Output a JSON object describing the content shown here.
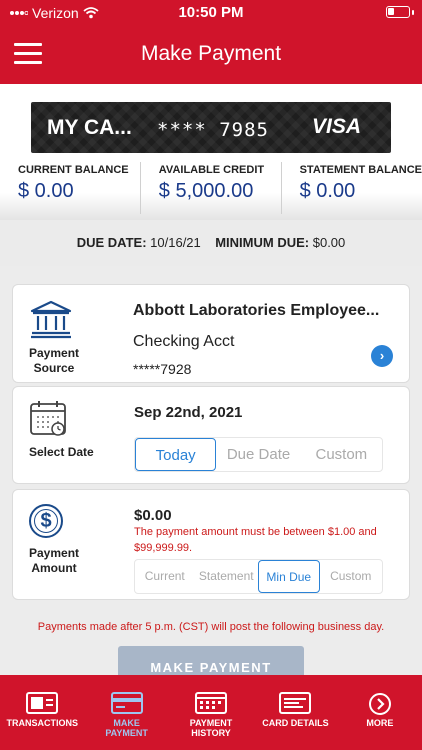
{
  "status_bar": {
    "carrier": "Verizon",
    "time": "10:50 PM"
  },
  "header": {
    "title": "Make Payment"
  },
  "card": {
    "name": "MY CA...",
    "number": "**** 7985",
    "brand": "VISA"
  },
  "balances": [
    {
      "label": "CURRENT BALANCE",
      "value": "$ 0.00"
    },
    {
      "label": "AVAILABLE CREDIT",
      "value": "$ 5,000.00"
    },
    {
      "label": "STATEMENT BALANCE",
      "value": "$ 0.00"
    }
  ],
  "due": {
    "due_label": "DUE DATE:",
    "due_date": "10/16/21",
    "min_label": "MINIMUM DUE:",
    "min_value": "$0.00"
  },
  "payment_source": {
    "label_line1": "Payment",
    "label_line2": "Source",
    "bank": "Abbott Laboratories Employee...",
    "account_type": "Checking Acct",
    "account_number": "*****7928",
    "icon": "bank-icon"
  },
  "select_date": {
    "label": "Select Date",
    "date": "Sep 22nd, 2021",
    "options": [
      "Today",
      "Due Date",
      "Custom"
    ],
    "selected": "Today",
    "icon": "calendar-icon"
  },
  "payment_amount": {
    "label_line1": "Payment",
    "label_line2": "Amount",
    "amount": "$0.00",
    "error": "The payment amount must be between $1.00 and $99,999.99.",
    "options": [
      "Current",
      "Statement",
      "Min Due",
      "Custom"
    ],
    "selected": "Min Due",
    "icon": "dollar-icon"
  },
  "notice": "Payments made after 5 p.m. (CST) will post the following business day.",
  "make_payment_button": "MAKE PAYMENT",
  "tabs": [
    {
      "label": "TRANSACTIONS",
      "icon": "transactions-icon"
    },
    {
      "label_line1": "MAKE",
      "label_line2": "PAYMENT",
      "icon": "payment-card-icon",
      "active": true
    },
    {
      "label_line1": "PAYMENT",
      "label_line2": "HISTORY",
      "icon": "history-icon"
    },
    {
      "label": "CARD DETAILS",
      "icon": "card-details-icon"
    },
    {
      "label": "MORE",
      "icon": "more-icon"
    }
  ],
  "colors": {
    "brand_red": "#d0142b",
    "accent_blue": "#2a82d6",
    "balance_blue": "#1a3a8a",
    "error_red": "#cc1a1a",
    "disabled_button": "#a8b6c8"
  }
}
